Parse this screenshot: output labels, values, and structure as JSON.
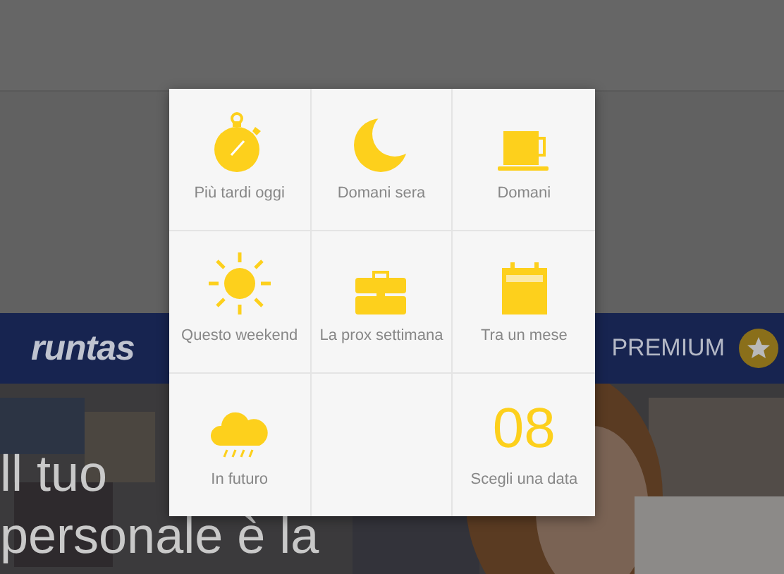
{
  "banner": {
    "logo": "runtas",
    "premium": "PREMIUM"
  },
  "hero": {
    "lines": [
      "ll tuo",
      "personale è la"
    ]
  },
  "dialog": {
    "cells": [
      {
        "kind": "stopwatch",
        "label": "Più tardi oggi"
      },
      {
        "kind": "moon",
        "label": "Domani sera"
      },
      {
        "kind": "cup",
        "label": "Domani"
      },
      {
        "kind": "sun",
        "label": "Questo weekend"
      },
      {
        "kind": "briefcase",
        "label": "La prox settimana"
      },
      {
        "kind": "calendar",
        "label": "Tra un mese"
      },
      {
        "kind": "cloud",
        "label": "In futuro"
      },
      {
        "kind": "empty"
      },
      {
        "kind": "date",
        "number": "08",
        "label": "Scegli una data"
      }
    ]
  }
}
